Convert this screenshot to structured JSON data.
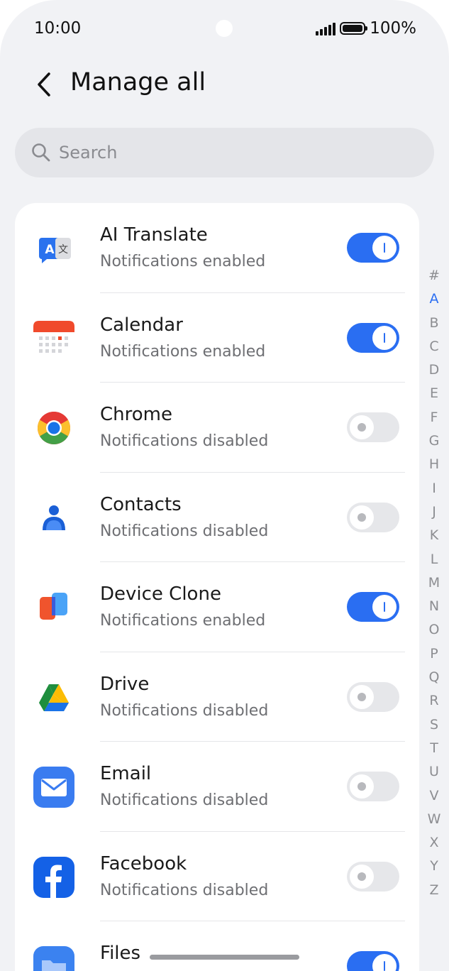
{
  "status_bar": {
    "time": "10:00",
    "battery": "100%"
  },
  "header": {
    "title": "Manage all"
  },
  "search": {
    "placeholder": "Search"
  },
  "apps": [
    {
      "name": "AI Translate",
      "status": "Notifications enabled",
      "enabled": true,
      "icon": "translate-icon"
    },
    {
      "name": "Calendar",
      "status": "Notifications enabled",
      "enabled": true,
      "icon": "calendar-icon"
    },
    {
      "name": "Chrome",
      "status": "Notifications disabled",
      "enabled": false,
      "icon": "chrome-icon"
    },
    {
      "name": "Contacts",
      "status": "Notifications disabled",
      "enabled": false,
      "icon": "contacts-icon"
    },
    {
      "name": "Device Clone",
      "status": "Notifications enabled",
      "enabled": true,
      "icon": "device-clone-icon"
    },
    {
      "name": "Drive",
      "status": "Notifications disabled",
      "enabled": false,
      "icon": "drive-icon"
    },
    {
      "name": "Email",
      "status": "Notifications disabled",
      "enabled": false,
      "icon": "email-icon"
    },
    {
      "name": "Facebook",
      "status": "Notifications disabled",
      "enabled": false,
      "icon": "facebook-icon"
    },
    {
      "name": "Files",
      "status": "",
      "enabled": true,
      "icon": "files-icon"
    }
  ],
  "alpha_index": [
    "#",
    "A",
    "B",
    "C",
    "D",
    "E",
    "F",
    "G",
    "H",
    "I",
    "J",
    "K",
    "L",
    "M",
    "N",
    "O",
    "P",
    "Q",
    "R",
    "S",
    "T",
    "U",
    "V",
    "W",
    "X",
    "Y",
    "Z"
  ],
  "alpha_active": "A",
  "colors": {
    "accent": "#2a6ef2",
    "background": "#f1f2f5"
  }
}
